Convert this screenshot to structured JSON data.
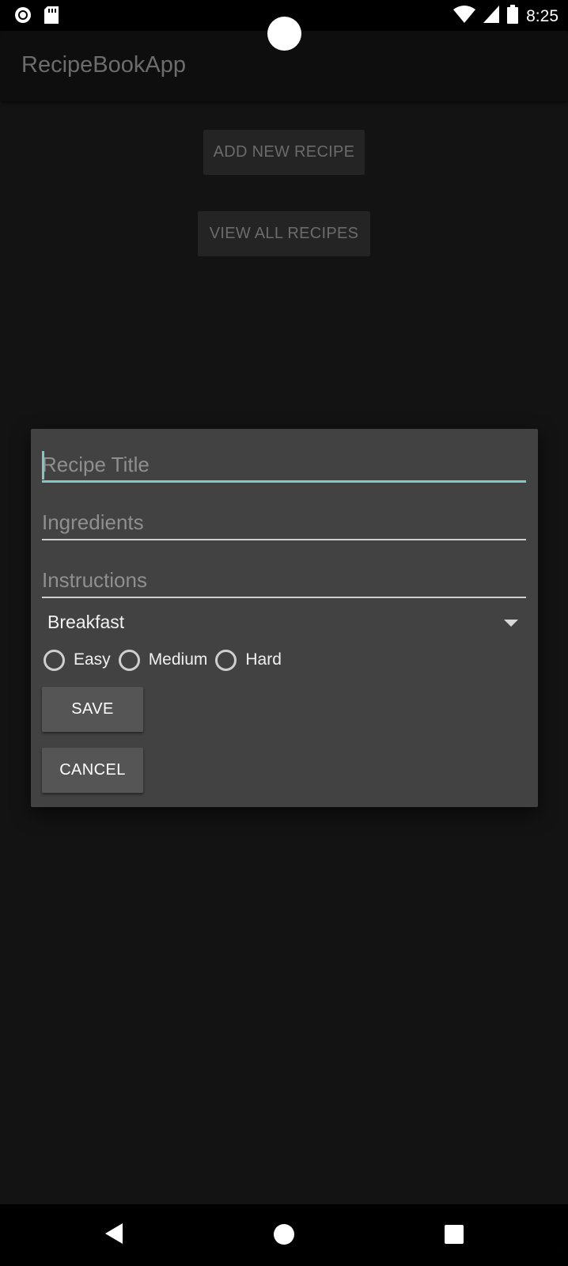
{
  "status_bar": {
    "time": "8:25",
    "icons": [
      "record-icon",
      "sd-card-icon",
      "wifi-icon",
      "cell-signal-icon",
      "battery-icon"
    ]
  },
  "app_bar": {
    "title": "RecipeBookApp"
  },
  "main": {
    "add_button_label": "ADD NEW RECIPE",
    "view_button_label": "VIEW ALL RECIPES"
  },
  "dialog": {
    "title_placeholder": "Recipe Title",
    "ingredients_placeholder": "Ingredients",
    "instructions_placeholder": "Instructions",
    "category_selected": "Breakfast",
    "difficulty_options": [
      "Easy",
      "Medium",
      "Hard"
    ],
    "save_label": "SAVE",
    "cancel_label": "CANCEL"
  },
  "nav_bar": {
    "icons": [
      "back-icon",
      "home-icon",
      "recents-icon"
    ]
  },
  "colors": {
    "accent": "#7fc9c2",
    "background": "#131313",
    "dialog": "#424242",
    "button": "#555555"
  }
}
